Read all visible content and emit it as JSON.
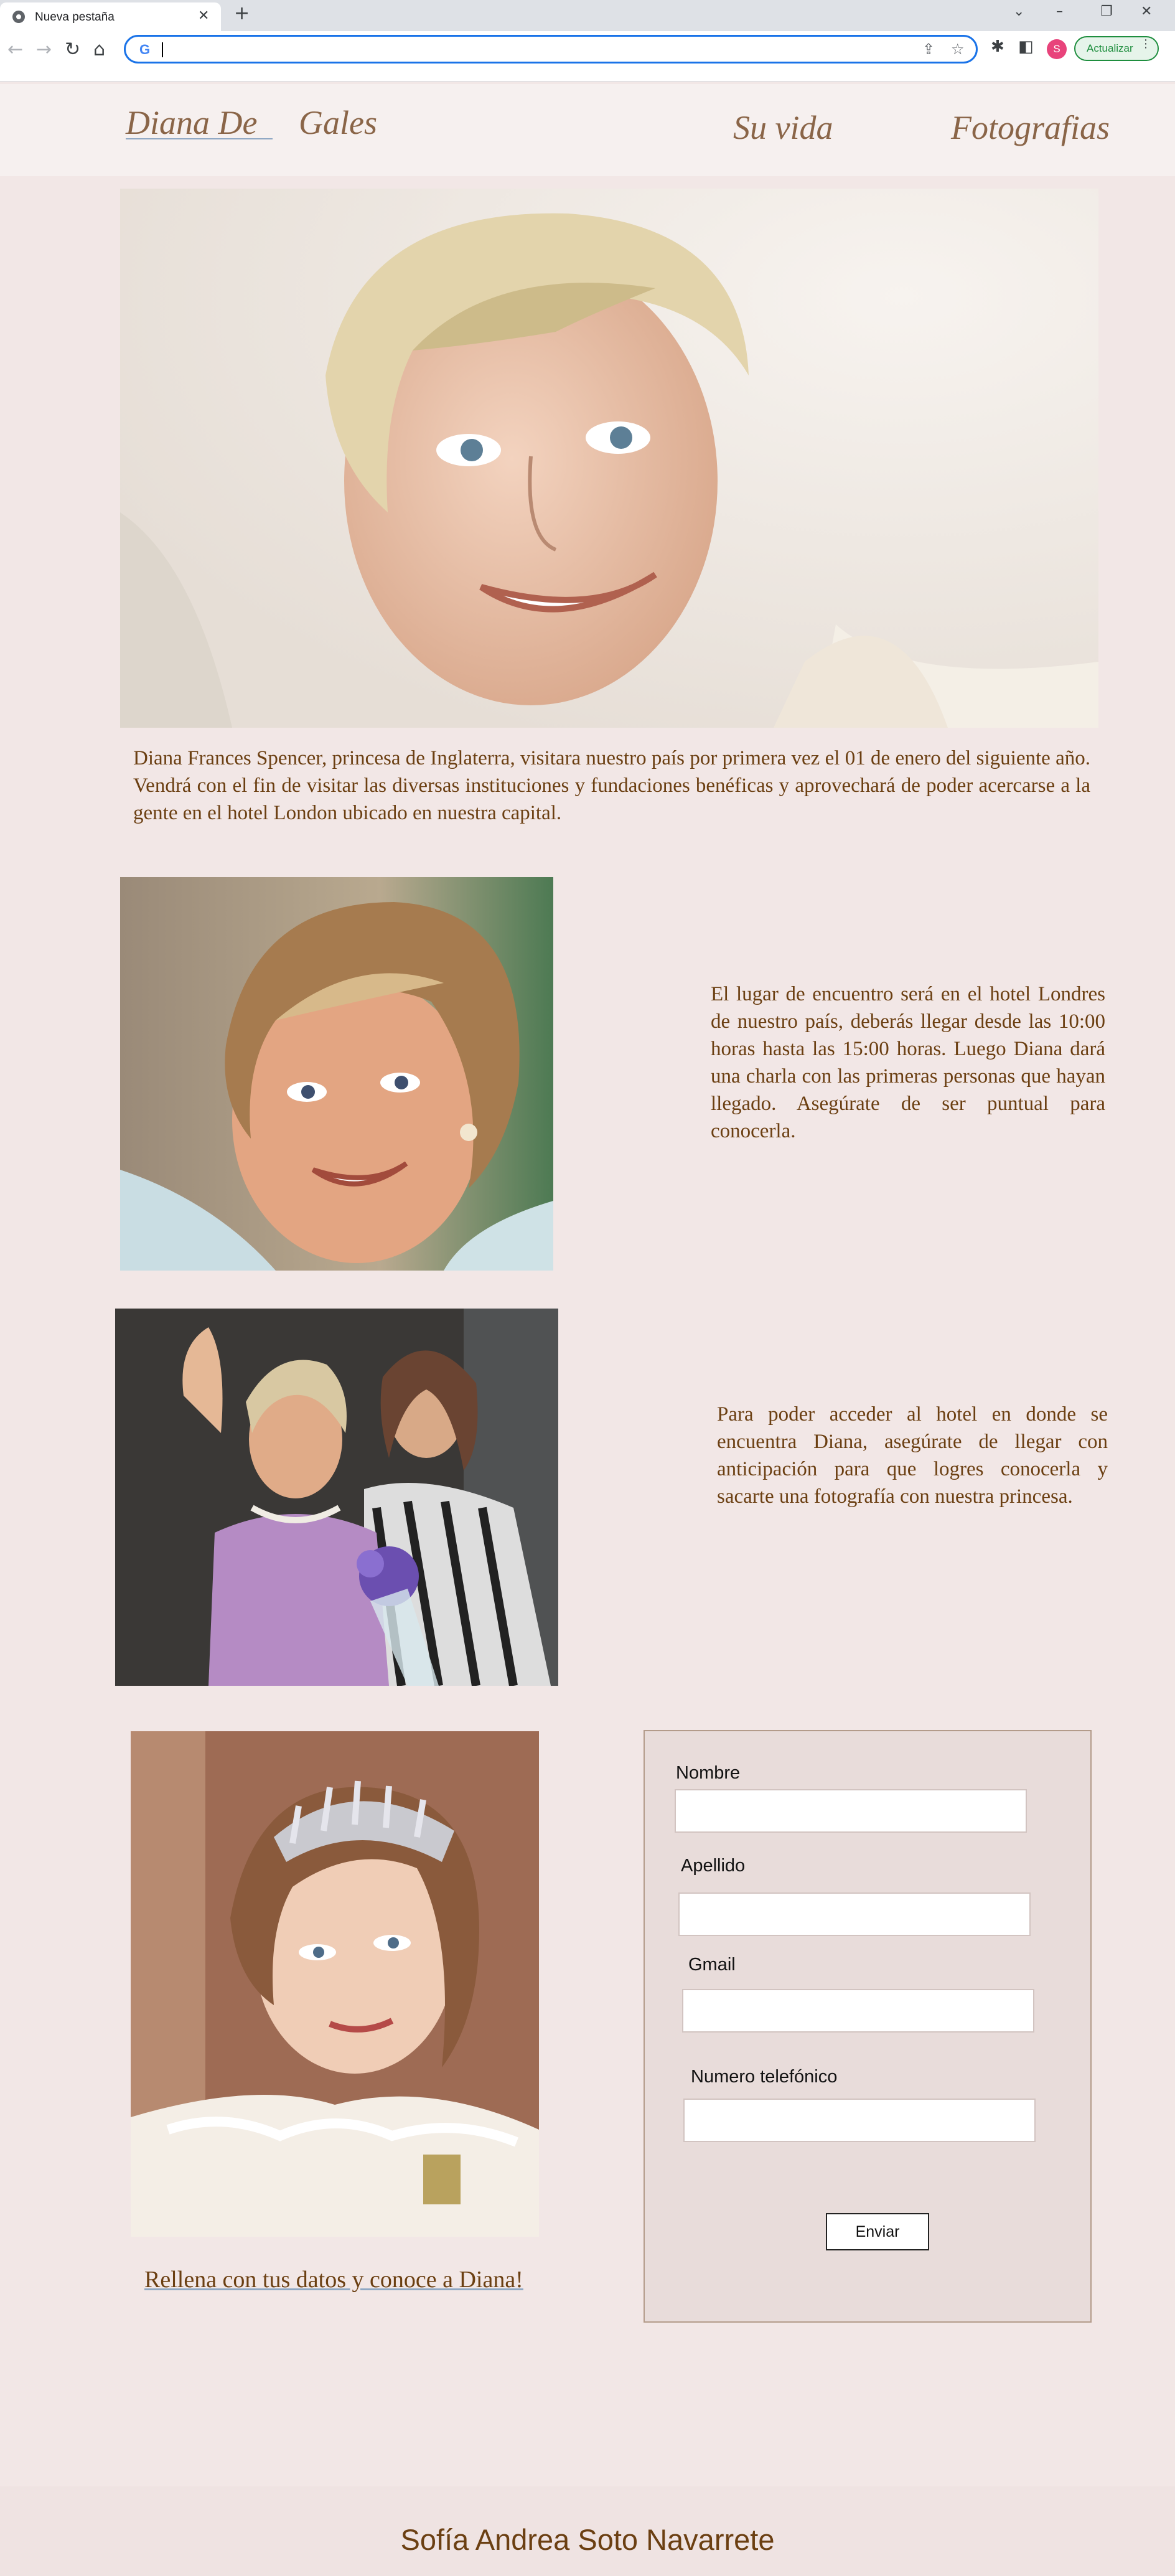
{
  "browser": {
    "tab_title": "Nueva pestaña",
    "address_value": "",
    "update_button": "Actualizar",
    "avatar_initial": "S"
  },
  "site": {
    "nav": {
      "logo_part1": "Diana De",
      "logo_part2": "Gales",
      "link_life": "Su vida",
      "link_photos": "Fotografias"
    },
    "intro_text": "Diana Frances Spencer, princesa de Inglaterra, visitara nuestro país por primera vez el 01 de enero del siguiente año. Vendrá con el fin de visitar las diversas instituciones y fundaciones benéficas y aprovechará de poder acercarse a la gente en el hotel London ubicado en nuestra capital.",
    "section_meeting_text": "El lugar de encuentro será en el hotel Londres de nuestro país, deberás llegar desde las 10:00 horas hasta las 15:00 horas. Luego Diana dará una charla con las primeras personas que hayan llegado. Asegúrate de ser puntual para conocerla.",
    "section_access_text": "Para poder acceder al hotel en donde se encuentra Diana, asegúrate de llegar con anticipación para que logres conocerla y sacarte una fotografía con nuestra princesa.",
    "cta_text": "Rellena con tus datos y conoce a Diana!",
    "form": {
      "label_name": "Nombre",
      "label_surname": "Apellido",
      "label_email": "Gmail",
      "label_phone": "Numero telefónico",
      "submit_label": "Enviar"
    },
    "footer_name": "Sofía Andrea Soto Navarrete"
  },
  "colors": {
    "page_bg": "#f2e7e6",
    "nav_text": "#8a6548",
    "body_text": "#6b3f12",
    "accent": "#1a73e8"
  }
}
